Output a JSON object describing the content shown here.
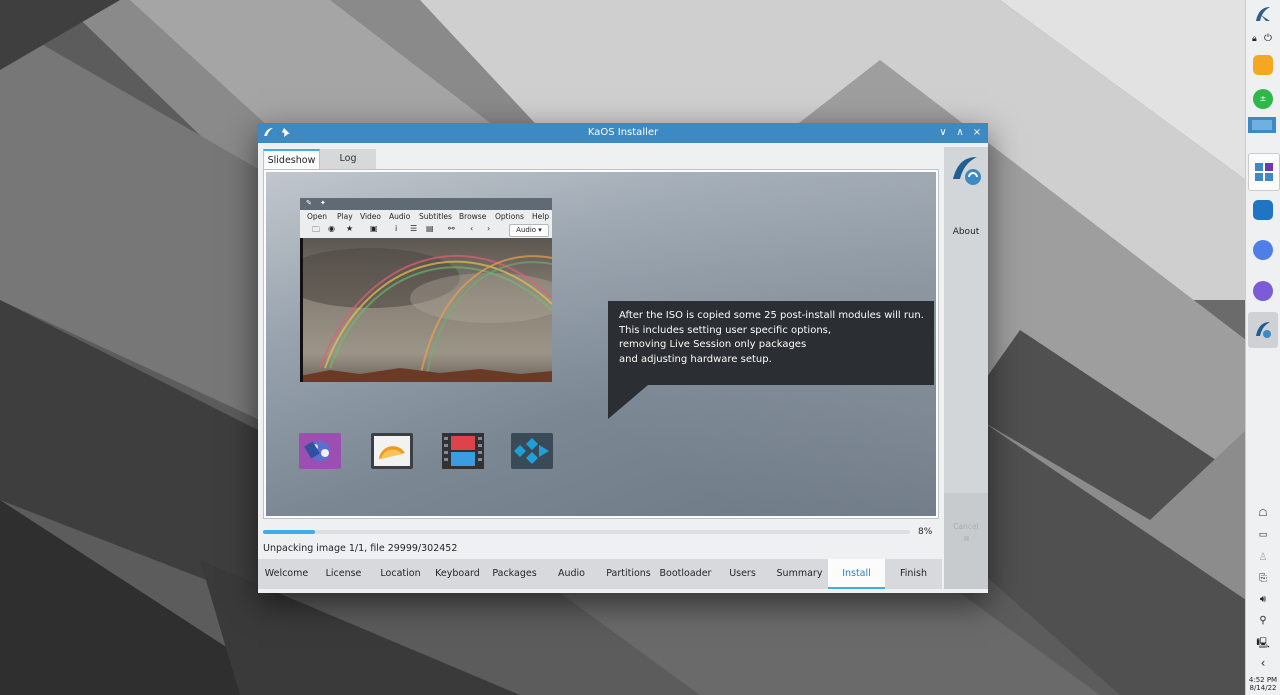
{
  "window": {
    "title": "KaOS Installer",
    "controls": {
      "minimize": "∨",
      "maximize": "∧",
      "close": "×"
    }
  },
  "tabs": [
    {
      "label": "Slideshow",
      "active": true
    },
    {
      "label": "Log",
      "active": false
    }
  ],
  "slide": {
    "player_menu": [
      "Open",
      "Play",
      "Video",
      "Audio",
      "Subtitles",
      "Browse",
      "Options",
      "Help"
    ],
    "player_audio_select": "Audio",
    "text_lines": [
      "After the ISO is copied some 25 post-install modules will run.",
      "This includes setting user specific options,",
      "removing Live Session only packages",
      "and adjusting hardware setup."
    ]
  },
  "sidebar": {
    "about_label": "About",
    "cancel_label": "Cancel"
  },
  "progress": {
    "percent": 8,
    "percent_label": "8%",
    "status": "Unpacking image 1/1, file 29999/302452"
  },
  "steps": [
    {
      "label": "Welcome",
      "active": false
    },
    {
      "label": "License",
      "active": false
    },
    {
      "label": "Location",
      "active": false
    },
    {
      "label": "Keyboard",
      "active": false
    },
    {
      "label": "Packages",
      "active": false
    },
    {
      "label": "Audio",
      "active": false
    },
    {
      "label": "Partitions",
      "active": false
    },
    {
      "label": "Bootloader",
      "active": false
    },
    {
      "label": "Users",
      "active": false
    },
    {
      "label": "Summary",
      "active": false
    },
    {
      "label": "Install",
      "active": true
    },
    {
      "label": "Finish",
      "active": false
    }
  ],
  "panel": {
    "clock_time": "4:52 PM",
    "clock_date": "8/14/22"
  },
  "colors": {
    "accent": "#3daee9",
    "titlebar": "#3c89c4",
    "bubble": "#2b2f33"
  }
}
